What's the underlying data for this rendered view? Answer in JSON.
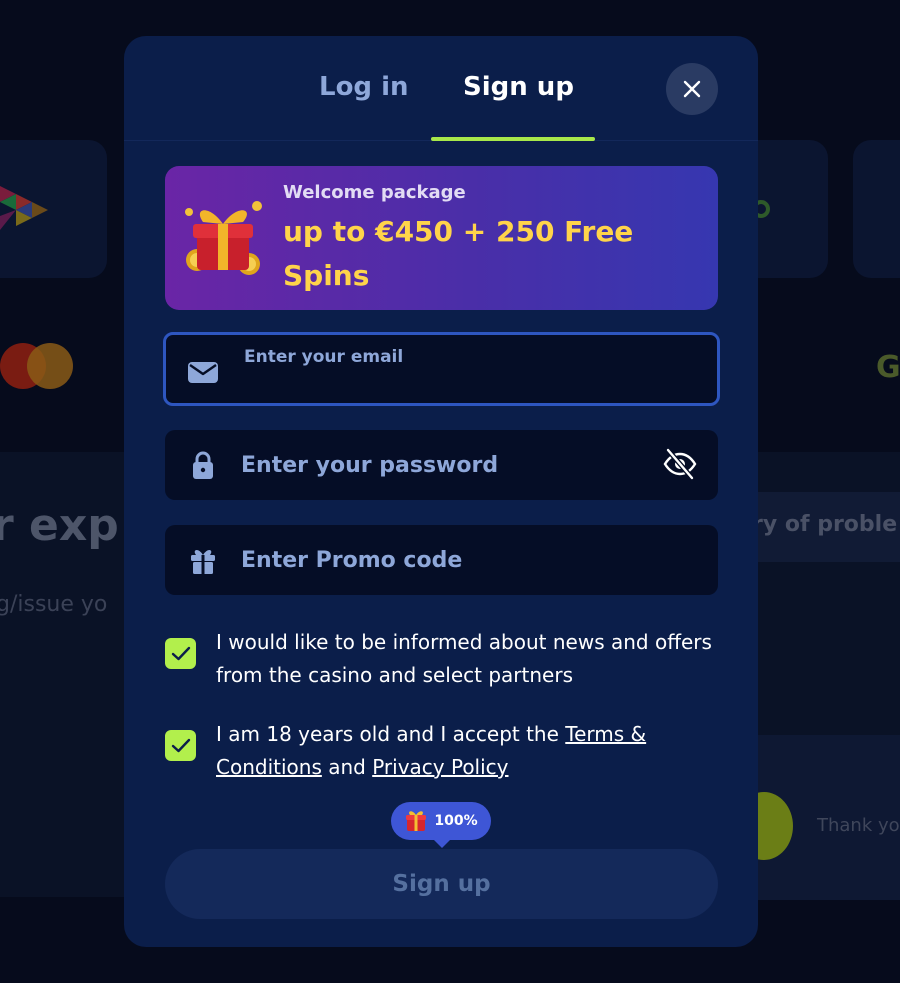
{
  "background": {
    "heading_fragment": "r exp",
    "subtext_fragment": "g/issue yo",
    "problem_fragment": "ry of proble",
    "thanks_fragment": "Thank yo",
    "google_glyph": "G"
  },
  "modal": {
    "tabs": [
      {
        "label": "Log in",
        "active": false
      },
      {
        "label": "Sign up",
        "active": true
      }
    ],
    "promo": {
      "subtitle": "Welcome package",
      "title": "up to €450 + 250 Free Spins"
    },
    "form": {
      "email": {
        "label": "Enter your email",
        "value": ""
      },
      "password": {
        "placeholder": "Enter your password",
        "value": ""
      },
      "promo_code": {
        "placeholder": "Enter Promo code",
        "value": ""
      }
    },
    "consents": {
      "news": {
        "checked": true,
        "text": "I would like to be informed about news and offers from the casino and select partners"
      },
      "age": {
        "checked": true,
        "text_before": "I am 18 years old and I accept the ",
        "terms_link": "Terms & Conditions",
        "text_middle": " and ",
        "privacy_link": "Privacy Policy"
      }
    },
    "badge": {
      "text": "100%",
      "icon": "gift-icon"
    },
    "submit_label": "Sign up"
  },
  "colors": {
    "modal_bg": "#0b1e4a",
    "accent_green": "#a8e84a",
    "promo_yellow": "#ffd44a",
    "badge_blue": "#3e56d6"
  }
}
